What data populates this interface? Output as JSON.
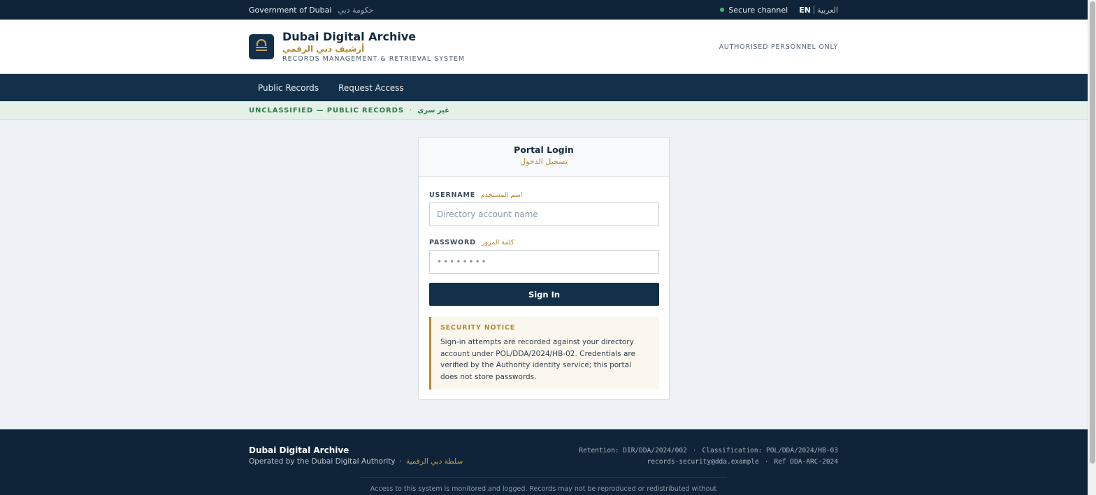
{
  "topbar": {
    "gov_en": "Government of Dubai",
    "gov_ar": "حكومة دبي",
    "secure": "Secure channel",
    "lang_en": "EN",
    "lang_ar": "العربية",
    "status_color": "#3fb96b"
  },
  "header": {
    "title": "Dubai Digital Archive",
    "title_ar": "أرشيف دبي الرقمي",
    "subtitle": "RECORDS MANAGEMENT & RETRIEVAL SYSTEM",
    "notice": "AUTHORISED PERSONNEL ONLY",
    "logo_icon": "archive-lock-icon"
  },
  "nav": {
    "items": [
      {
        "label": "Public Records"
      },
      {
        "label": "Request Access"
      }
    ]
  },
  "classification": {
    "label": "UNCLASSIFIED — PUBLIC RECORDS",
    "separator": "·",
    "label_ar": "غير سري"
  },
  "login": {
    "title": "Portal Login",
    "title_ar": "تسجيل الدخول",
    "username_label": "USERNAME",
    "username_label_ar": "اسم المستخدم",
    "username_placeholder": "Directory account name",
    "username_value": "",
    "password_label": "PASSWORD",
    "password_label_ar": "كلمة المرور",
    "password_placeholder": "••••••••",
    "submit": "Sign In"
  },
  "security_notice": {
    "title": "SECURITY NOTICE",
    "text": "Sign-in attempts are recorded against your directory account under POL/DDA/2024/HB-02. Credentials are verified by the Authority identity service; this portal does not store passwords."
  },
  "footer": {
    "title": "Dubai Digital Archive",
    "operated": "Operated by the Dubai Digital Authority",
    "separator": "·",
    "operated_ar": "سلطة دبي الرقمية",
    "retention": "Retention: DIR/DDA/2024/002",
    "classification": "Classification: POL/DDA/2024/HB-03",
    "email": "records-security@dda.example",
    "ref": "Ref DDA-ARC-2024",
    "legal": "Access to this system is monitored and logged. Records may not be reproduced or redistributed without"
  },
  "colors": {
    "navy": "#12304a",
    "gold": "#b8892e",
    "green": "#2c7a4b"
  }
}
